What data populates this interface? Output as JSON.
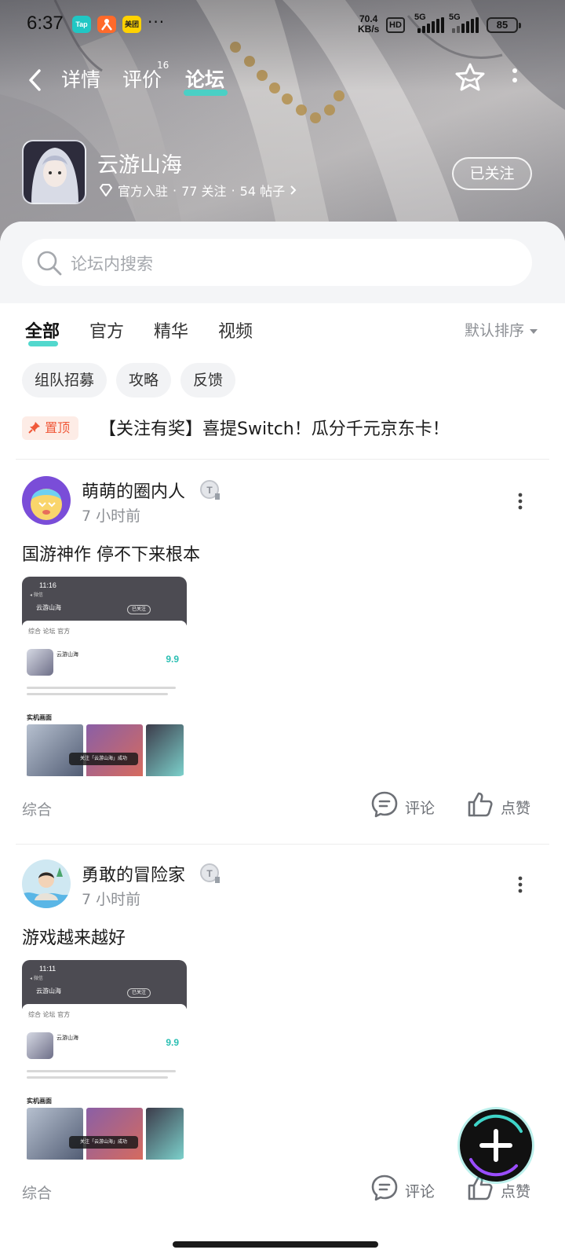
{
  "status_bar": {
    "time": "6:37",
    "apps": [
      "Tap",
      "闲鱼",
      "美团"
    ],
    "more": "···",
    "net_speed_value": "70.4",
    "net_speed_unit": "KB/s",
    "hd": "HD",
    "signal_1": "5G",
    "signal_2": "5G",
    "battery": "85"
  },
  "nav": {
    "tabs": [
      {
        "label": "详情"
      },
      {
        "label": "评价"
      },
      {
        "label": "论坛"
      }
    ],
    "review_count": "16",
    "active_tab": "论坛"
  },
  "game": {
    "name": "云游山海",
    "meta": {
      "badge": "官方入驻",
      "separator": "·",
      "followers": "77 关注",
      "posts": "54 帖子"
    },
    "follow_button": "已关注"
  },
  "search": {
    "placeholder": "论坛内搜索"
  },
  "filters": {
    "tabs": [
      {
        "label": "全部"
      },
      {
        "label": "官方"
      },
      {
        "label": "精华"
      },
      {
        "label": "视频"
      }
    ],
    "sort_label": "默认排序"
  },
  "chips": [
    {
      "label": "组队招募"
    },
    {
      "label": "攻略"
    },
    {
      "label": "反馈"
    }
  ],
  "pinned": {
    "badge": "置顶",
    "text": "【关注有奖】喜提Switch！瓜分千元京东卡！"
  },
  "posts": [
    {
      "author": "萌萌的圈内人",
      "time": "7 小时前",
      "title": "国游神作 停不下来根本",
      "category": "综合",
      "comment_label": "评论",
      "like_label": "点赞",
      "thumb": {
        "time": "11:16",
        "back_app": "◂ 微信",
        "title": "云游山海",
        "follow": "已关注",
        "tabs": "综合  论坛  官方",
        "game_name": "云游山海",
        "score": "9.9",
        "section": "实机画面",
        "toast": "关注「云游山海」成功"
      }
    },
    {
      "author": "勇敢的冒险家",
      "time": "7 小时前",
      "title": "游戏越来越好",
      "category": "综合",
      "comment_label": "评论",
      "like_label": "点赞",
      "thumb": {
        "time": "11:11",
        "back_app": "◂ 微信",
        "title": "云游山海",
        "follow": "已关注",
        "tabs": "综合  论坛  官方",
        "game_name": "云游山海",
        "score": "9.9",
        "section": "实机画面",
        "toast": "关注「云游山海」成功"
      }
    }
  ],
  "colors": {
    "accent": "#3fd4c8",
    "pin_red": "#f0593a",
    "muted_text": "#8c8f94"
  }
}
